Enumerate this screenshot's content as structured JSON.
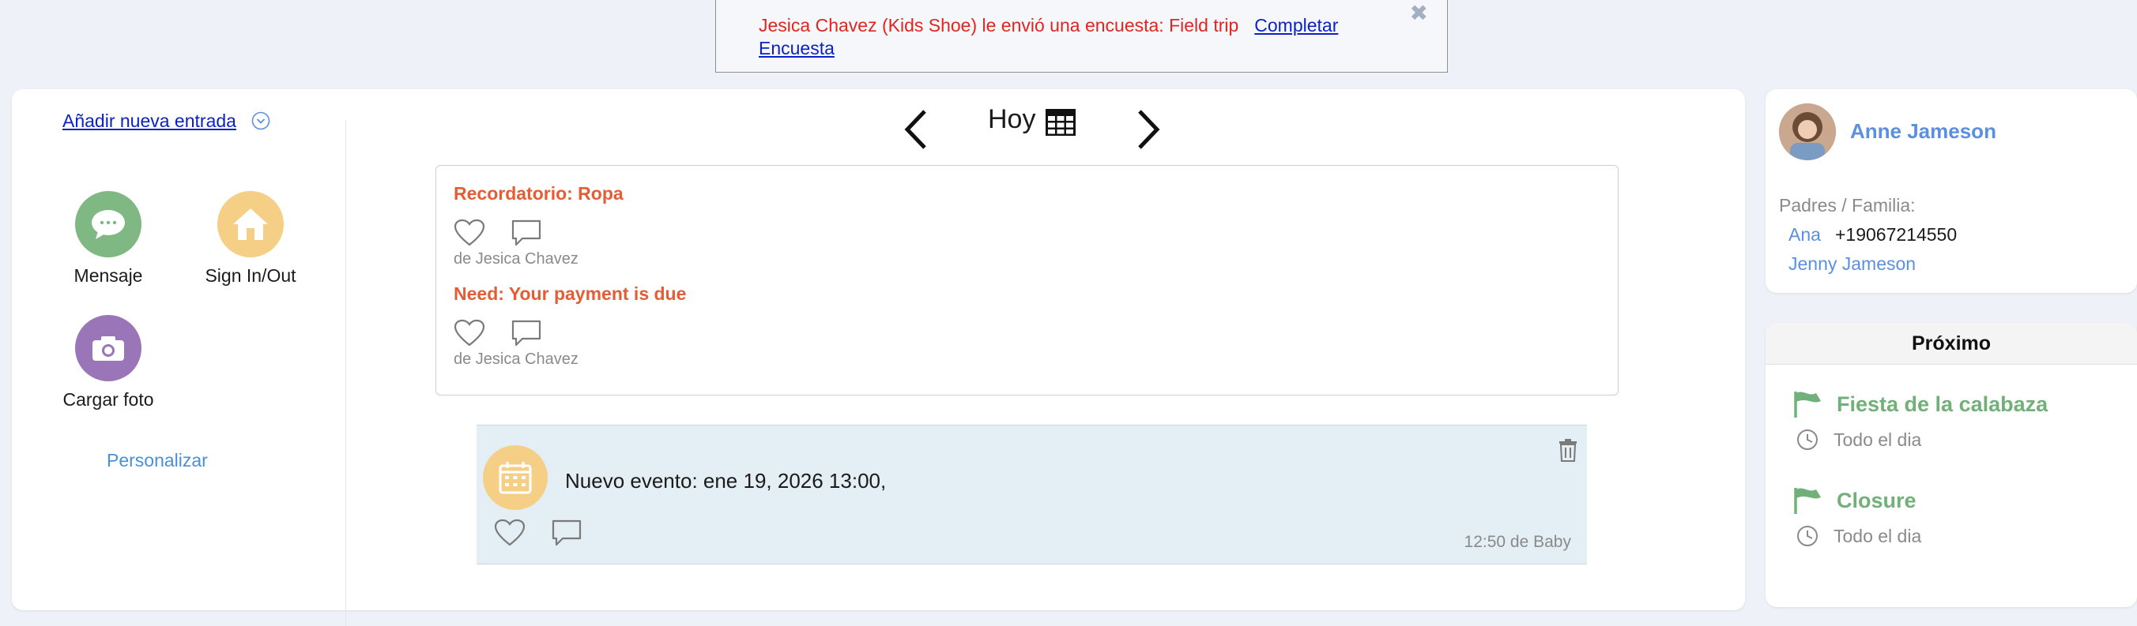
{
  "banner": {
    "message": "Jesica Chavez (Kids Shoe) le envió una encuesta: Field trip",
    "link": "Completar Encuesta"
  },
  "left": {
    "add_entry": "Añadir nueva entrada",
    "actions": [
      {
        "label": "Mensaje",
        "color": "#7fb883"
      },
      {
        "label": "Sign In/Out",
        "color": "#f6cf87"
      },
      {
        "label": "Cargar foto",
        "color": "#9a76b8"
      }
    ],
    "personalize": "Personalizar"
  },
  "date_nav": {
    "label": "Hoy"
  },
  "reminders": [
    {
      "title": "Recordatorio: Ropa",
      "from": "de Jesica Chavez"
    },
    {
      "title": "Need: Your payment is due",
      "from": "de Jesica Chavez"
    }
  ],
  "event": {
    "text": "Nuevo evento: ene 19, 2026 13:00,",
    "time": "12:50 de Baby"
  },
  "profile": {
    "name": "Anne Jameson",
    "family_label": "Padres / Familia:",
    "parents": [
      {
        "name": "Ana",
        "phone": "+19067214550"
      },
      {
        "name": "Jenny Jameson",
        "phone": ""
      }
    ]
  },
  "upcoming": {
    "title": "Próximo",
    "items": [
      {
        "title": "Fiesta de la calabaza",
        "time": "Todo el dia"
      },
      {
        "title": "Closure",
        "time": "Todo el dia"
      }
    ]
  },
  "colors": {
    "accent": "#5b8fe0",
    "reminder": "#e45d35",
    "flag": "#72b07a",
    "banner_text": "#e0261e"
  }
}
